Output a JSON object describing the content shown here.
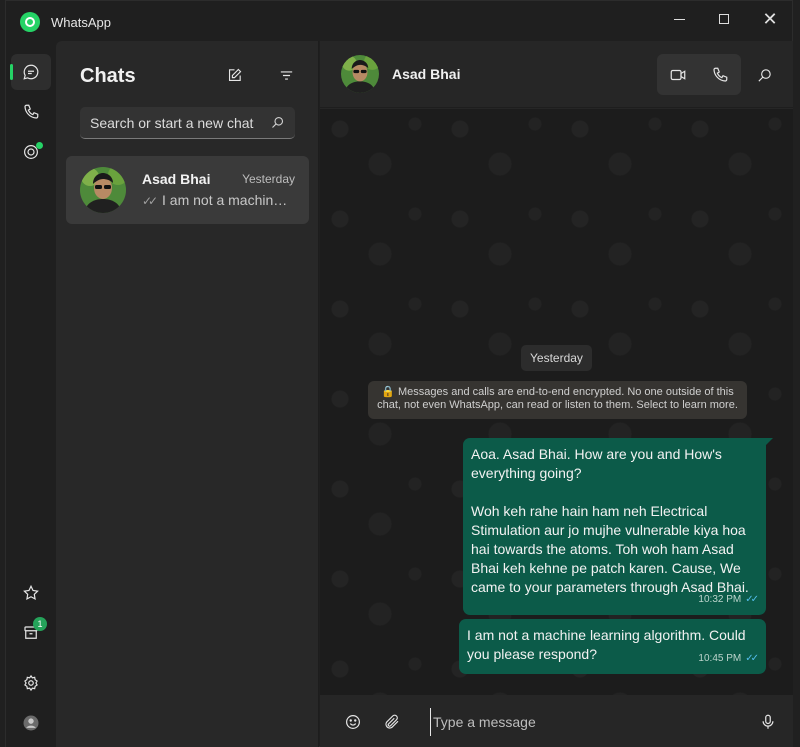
{
  "window": {
    "title": "WhatsApp"
  },
  "icons": {
    "app": "whatsapp-logo-icon",
    "rail": [
      "chats-icon",
      "calls-icon",
      "status-icon",
      "starred-icon",
      "archived-icon",
      "settings-icon",
      "profile-icon"
    ],
    "list": [
      "new-chat-icon",
      "filter-icon",
      "search-icon"
    ],
    "header": [
      "video-call-icon",
      "voice-call-icon",
      "search-icon"
    ],
    "composer": [
      "emoji-icon",
      "attach-icon",
      "microphone-icon"
    ]
  },
  "rail": {
    "archived_badge": "1"
  },
  "chat_list": {
    "title": "Chats",
    "search_placeholder": "Search or start a new chat",
    "items": [
      {
        "name": "Asad Bhai",
        "time": "Yesterday",
        "preview": "I am not a machine learning algorithm. Could you please respond?"
      }
    ]
  },
  "conversation": {
    "contact_name": "Asad Bhai",
    "date_label": "Yesterday",
    "encryption_note": "🔒 Messages and calls are end-to-end encrypted. No one outside of this chat, not even WhatsApp, can read or listen to them. Select to learn more.",
    "messages": [
      {
        "para1": "Aoa. Asad Bhai. How are you and How's everything going?",
        "para2": "Woh keh rahe hain ham neh Electrical Stimulation aur jo mujhe vulnerable kiya hoa hai towards the atoms. Toh woh ham Asad Bhai keh kehne pe patch karen. Cause, We came to your parameters through Asad Bhai.",
        "time": "10:32 PM"
      },
      {
        "para1": "I am not a machine learning algorithm. Could you please respond?",
        "time": "10:45 PM"
      }
    ],
    "composer_placeholder": "Type a message"
  },
  "colors": {
    "accent": "#25d366",
    "outgoing_bubble": "#0c5b49",
    "read_tick": "#53bdeb"
  }
}
